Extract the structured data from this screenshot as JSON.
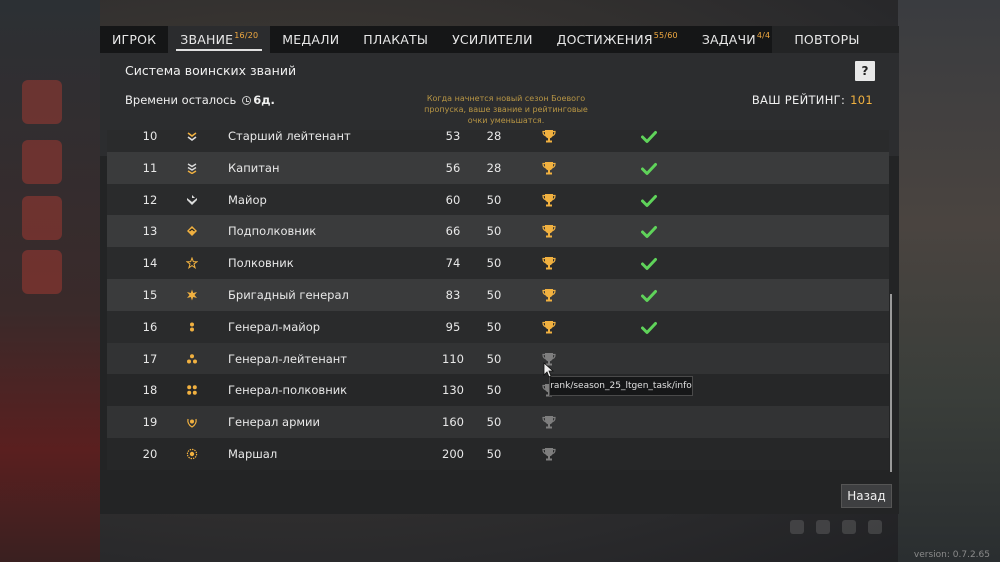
{
  "tabs": [
    {
      "label": "ИГРОК",
      "badge": ""
    },
    {
      "label": "ЗВАНИЕ",
      "badge": "16/20",
      "active": true
    },
    {
      "label": "МЕДАЛИ",
      "badge": ""
    },
    {
      "label": "ПЛАКАТЫ",
      "badge": ""
    },
    {
      "label": "УСИЛИТЕЛИ",
      "badge": ""
    },
    {
      "label": "ДОСТИЖЕНИЯ",
      "badge": "55/60"
    },
    {
      "label": "ЗАДАЧИ",
      "badge": "4/4"
    },
    {
      "label": "ПОВТОРЫ",
      "badge": ""
    }
  ],
  "header": {
    "title": "Система воинских званий",
    "help_label": "?",
    "time_label": "Времени осталось",
    "time_value": "6д.",
    "notice": "Когда начнется новый сезон Боевого пропуска, ваше звание и рейтинговые очки уменьшатся.",
    "rating_label": "ВАШ РЕЙТИНГ:",
    "rating_value": "101"
  },
  "ranks": [
    {
      "num": "10",
      "icon": "chevron-double-icon",
      "name": "Старший лейтенант",
      "a": "53",
      "b": "28",
      "earned": true
    },
    {
      "num": "11",
      "icon": "chevron-triple-icon",
      "name": "Капитан",
      "a": "56",
      "b": "28",
      "earned": true
    },
    {
      "num": "12",
      "icon": "chevron-heavy-icon",
      "name": "Майор",
      "a": "60",
      "b": "50",
      "earned": true
    },
    {
      "num": "13",
      "icon": "diamond-icon",
      "name": "Подполковник",
      "a": "66",
      "b": "50",
      "earned": true
    },
    {
      "num": "14",
      "icon": "star-outline-icon",
      "name": "Полковник",
      "a": "74",
      "b": "50",
      "earned": true
    },
    {
      "num": "15",
      "icon": "star-burst-icon",
      "name": "Бригадный генерал",
      "a": "83",
      "b": "50",
      "earned": true
    },
    {
      "num": "16",
      "icon": "two-dots-icon",
      "name": "Генерал-майор",
      "a": "95",
      "b": "50",
      "earned": true
    },
    {
      "num": "17",
      "icon": "three-dots-icon",
      "name": "Генерал-лейтенант",
      "a": "110",
      "b": "50",
      "earned": false
    },
    {
      "num": "18",
      "icon": "four-dots-icon",
      "name": "Генерал-полковник",
      "a": "130",
      "b": "50",
      "earned": false
    },
    {
      "num": "19",
      "icon": "wreath-star-icon",
      "name": "Генерал армии",
      "a": "160",
      "b": "50",
      "earned": false
    },
    {
      "num": "20",
      "icon": "sun-icon",
      "name": "Маршал",
      "a": "200",
      "b": "50",
      "earned": false
    }
  ],
  "tooltip": "rank/season_25_ltgen_task/info",
  "back_button": "Назад",
  "version": "version: 0.7.2.65",
  "colors": {
    "accent_gold": "#f1b140",
    "check_green": "#5fd35a",
    "cup_grey": "#8a8a8a"
  }
}
